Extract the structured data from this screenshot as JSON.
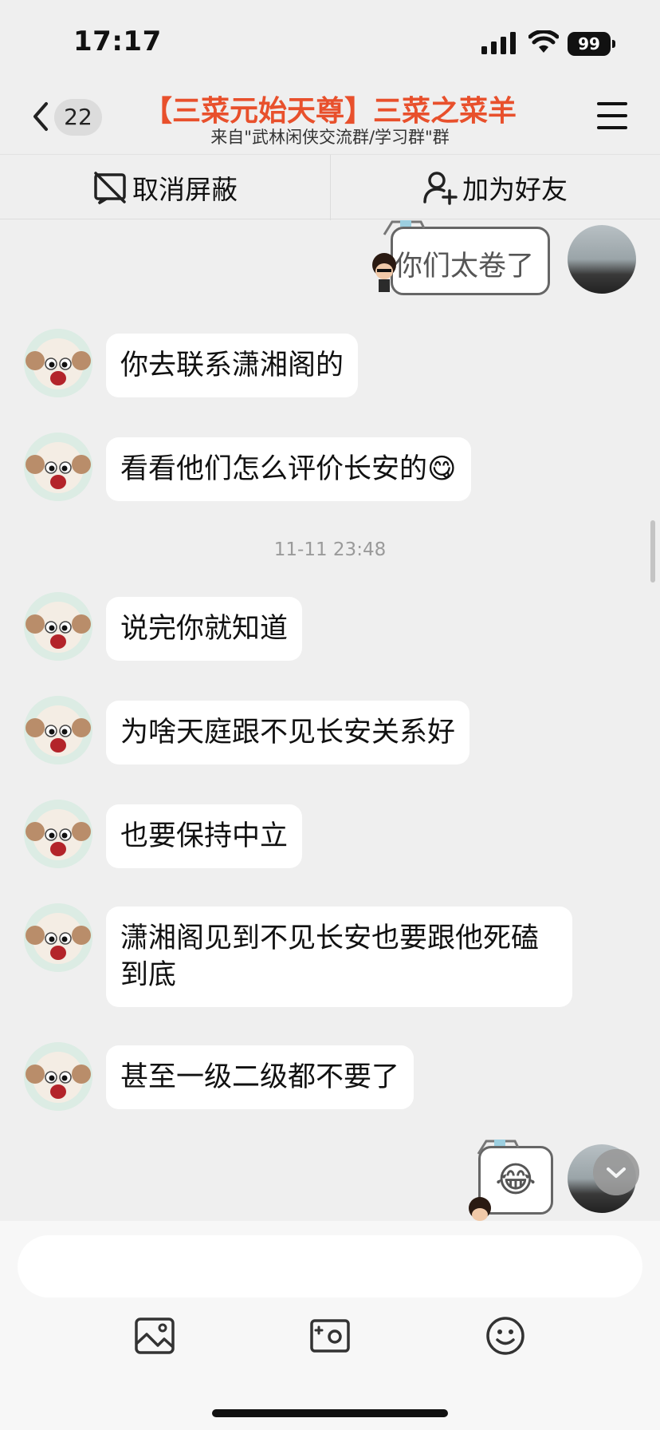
{
  "status_bar": {
    "time": "17:17",
    "battery": "99",
    "icons": [
      "signal-icon",
      "wifi-icon",
      "battery-icon"
    ]
  },
  "header": {
    "back_icon": "chevron-left-icon",
    "unread_count": "22",
    "title": "【三菜元始天尊】三菜之菜羊",
    "subtitle": "来自\"武林闲侠交流群/学习群\"群",
    "menu_icon": "hamburger-menu-icon",
    "title_color": "#e8502c"
  },
  "actions": {
    "unblock_label": "取消屏蔽",
    "unblock_icon": "unblock-icon",
    "add_friend_label": "加为好友",
    "add_friend_icon": "add-user-icon"
  },
  "messages": {
    "self_1": "你们太卷了",
    "m1": "你去联系潇湘阁的",
    "m2": "看看他们怎么评价长安的",
    "m2_emoji": "😋",
    "timestamp": "11-11 23:48",
    "m3": "说完你就知道",
    "m4": "为啥天庭跟不见长安关系好",
    "m5": "也要保持中立",
    "m6": "潇湘阁见到不见长安也要跟他死磕到底",
    "m7": "甚至一级二级都不要了",
    "self_2_emoji": "😂"
  },
  "input": {
    "placeholder": "",
    "toolbar": [
      "image-icon",
      "camera-icon",
      "emoji-icon"
    ]
  }
}
